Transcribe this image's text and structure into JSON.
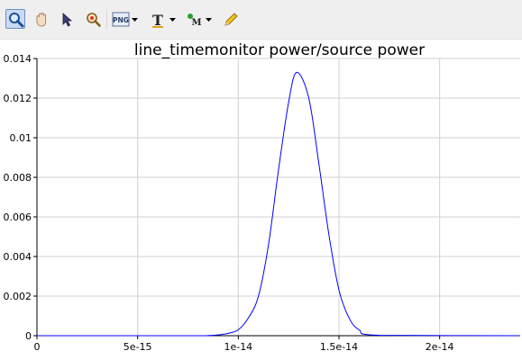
{
  "toolbar": {
    "buttons": [
      {
        "name": "zoom",
        "icon": "magnifier-zoom-icon",
        "active": true
      },
      {
        "name": "pan",
        "icon": "hand-pan-icon"
      },
      {
        "name": "select",
        "icon": "arrow-pointer-icon"
      },
      {
        "name": "data-cursor",
        "icon": "data-cursor-icon"
      },
      {
        "name": "export-png",
        "icon": "png-export-icon",
        "label": "PNG",
        "dropdown": true
      },
      {
        "name": "text",
        "icon": "text-tool-icon",
        "label": "T",
        "dropdown": true
      },
      {
        "name": "marker",
        "icon": "marker-tool-icon",
        "label": "M",
        "dropdown": true
      },
      {
        "name": "draw",
        "icon": "pencil-icon"
      }
    ]
  },
  "chart_data": {
    "type": "line",
    "title": "line_timemonitor power/source power",
    "xlabel": "",
    "ylabel": "",
    "xlim": [
      0,
      2.4e-14
    ],
    "ylim": [
      0,
      0.014
    ],
    "x_ticks": [
      0,
      5e-15,
      1e-14,
      1.5e-14,
      2e-14
    ],
    "x_tick_labels": [
      "0",
      "5e-15",
      "1e-14",
      "1.5e-14",
      "2e-14"
    ],
    "y_ticks": [
      0,
      0.002,
      0.004,
      0.006,
      0.008,
      0.01,
      0.012,
      0.014
    ],
    "y_tick_labels": [
      "0",
      "0.002",
      "0.004",
      "0.006",
      "0.008",
      "0.01",
      "0.012",
      "0.014"
    ],
    "grid": true,
    "series": [
      {
        "color": "#0000ff",
        "x": [
          0,
          8e-15,
          8.5e-15,
          9e-15,
          9.5e-15,
          1e-14,
          1.05e-14,
          1.1e-14,
          1.15e-14,
          1.2e-14,
          1.25e-14,
          1.29e-14,
          1.35e-14,
          1.4e-14,
          1.45e-14,
          1.5e-14,
          1.55e-14,
          1.6e-14,
          1.7e-14,
          2.4e-14
        ],
        "y": [
          0,
          0,
          1e-05,
          4e-05,
          0.00012,
          0.0003,
          0.0009,
          0.002,
          0.0046,
          0.0084,
          0.0118,
          0.0133,
          0.012,
          0.0087,
          0.0051,
          0.0023,
          0.0009,
          0.0003,
          2e-05,
          0
        ]
      }
    ]
  }
}
